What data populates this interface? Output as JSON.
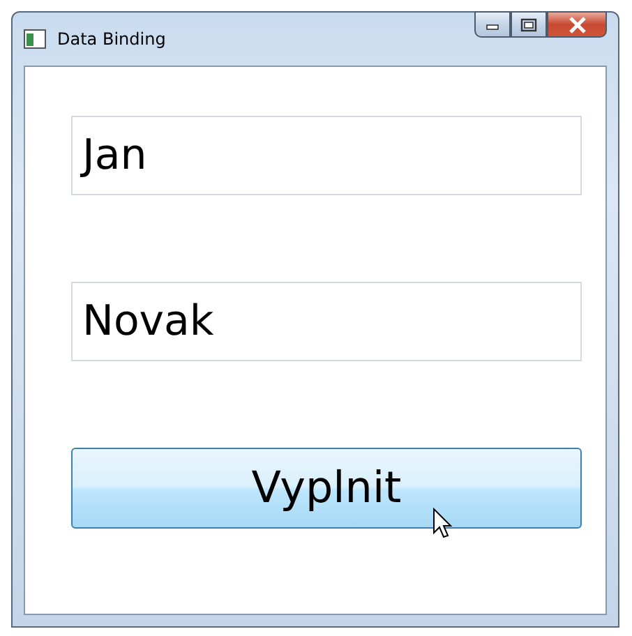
{
  "window": {
    "title": "Data Binding"
  },
  "fields": [
    {
      "value": "Jan"
    },
    {
      "value": "Novak"
    }
  ],
  "button": {
    "label": "Vyplnit",
    "hovered": true
  }
}
